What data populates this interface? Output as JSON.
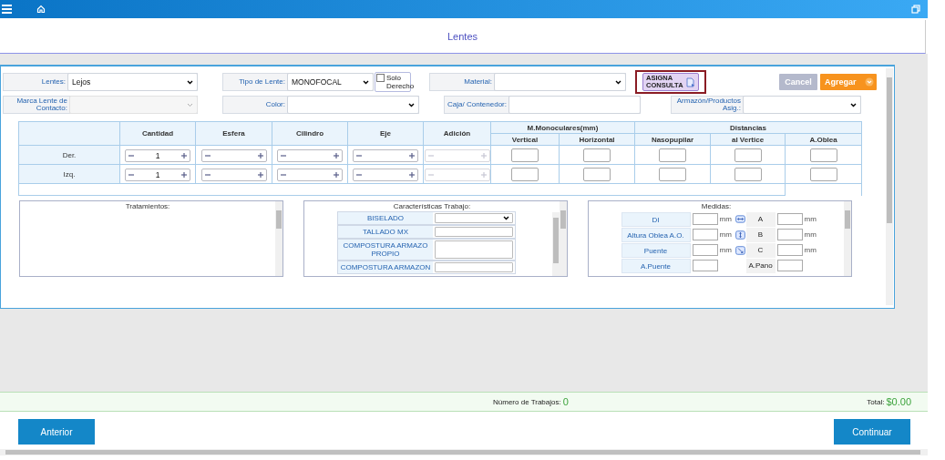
{
  "page_title": "Lentes",
  "form": {
    "row_1": [
      {
        "kind": "select",
        "label": "Lentes:",
        "value": "Lejos",
        "disabled": false
      },
      {
        "kind": "select",
        "label": "Tipo de Lente:",
        "value": "MONOFOCAL",
        "disabled": false,
        "checkbox": {
          "label": "Solo Derecho",
          "checked": false
        }
      },
      {
        "kind": "select",
        "label": "Material:",
        "disabled": false
      }
    ],
    "assign_button": {
      "label": "ASIGNA CONSULTA",
      "highlighted": true
    },
    "buttons": [
      {
        "kind": "cancel",
        "label": "Cancel"
      },
      {
        "kind": "add",
        "label": "Agregar"
      }
    ],
    "row_2": [
      {
        "kind": "select",
        "label": "Marca Lente de Contacto:",
        "disabled": true
      },
      {
        "kind": "select",
        "label": "Color:",
        "disabled": false
      },
      {
        "kind": "input",
        "label": "Caja/ Contenedor:"
      },
      {
        "kind": "select",
        "label": "Armazón/Productos Asig.:",
        "disabled": false
      }
    ]
  },
  "lens_table": {
    "columns": [
      "Cantidad",
      "Esfera",
      "Cilindro",
      "Eje",
      "Adición"
    ],
    "groups": [
      {
        "label": "M.Monoculares(mm)",
        "columns": [
          "Vertical",
          "Horizontal"
        ]
      },
      {
        "label": "Distancias",
        "columns": [
          "Nasopupilar",
          "al Vertice",
          "A.Oblea"
        ]
      }
    ],
    "rows": [
      {
        "label": "Der.",
        "cells": [
          {
            "kind": "stepper",
            "value": "1",
            "disabled": false
          },
          {
            "kind": "stepper",
            "disabled": false
          },
          {
            "kind": "stepper",
            "disabled": false
          },
          {
            "kind": "stepper",
            "disabled": false
          },
          {
            "kind": "stepper",
            "disabled": true
          },
          {
            "kind": "input"
          },
          {
            "kind": "input"
          },
          {
            "kind": "input"
          },
          {
            "kind": "input"
          },
          {
            "kind": "input"
          }
        ]
      },
      {
        "label": "Izq.",
        "cells": [
          {
            "kind": "stepper",
            "value": "1",
            "disabled": false
          },
          {
            "kind": "stepper",
            "disabled": false
          },
          {
            "kind": "stepper",
            "disabled": false
          },
          {
            "kind": "stepper",
            "disabled": false
          },
          {
            "kind": "stepper",
            "disabled": true
          },
          {
            "kind": "input"
          },
          {
            "kind": "input"
          },
          {
            "kind": "input"
          },
          {
            "kind": "input"
          },
          {
            "kind": "input"
          }
        ]
      }
    ]
  },
  "treatments": {
    "title": "Tratamientos:"
  },
  "work_features": {
    "title": "Características Trabajo:",
    "rows": [
      {
        "label": "BISELADO",
        "kind": "select"
      },
      {
        "label": "TALLADO MX",
        "kind": "input"
      },
      {
        "label": "COMPOSTURA ARMAZO PROPIO",
        "kind": "input"
      },
      {
        "label": "COMPOSTURA ARMAZON",
        "kind": "input"
      }
    ]
  },
  "measures": {
    "title": "Medidas:",
    "rows": [
      {
        "label": "DI",
        "unit": "mm",
        "letter": "A",
        "unit_2": "mm"
      },
      {
        "label": "Altura Oblea A.O.",
        "unit": "mm",
        "letter": "B",
        "unit_2": "mm"
      },
      {
        "label": "Puente",
        "unit": "mm",
        "letter": "C",
        "unit_2": "mm"
      },
      {
        "label": "A.Puente",
        "letter": "A.Pano"
      }
    ]
  },
  "footer": {
    "jobs_label": "Número de Trabajos:",
    "jobs_count": "0",
    "total_label": "Total:",
    "total": "$0.00"
  },
  "nav_buttons": [
    {
      "label": "Anterior"
    },
    {
      "label": "Continuar"
    }
  ]
}
